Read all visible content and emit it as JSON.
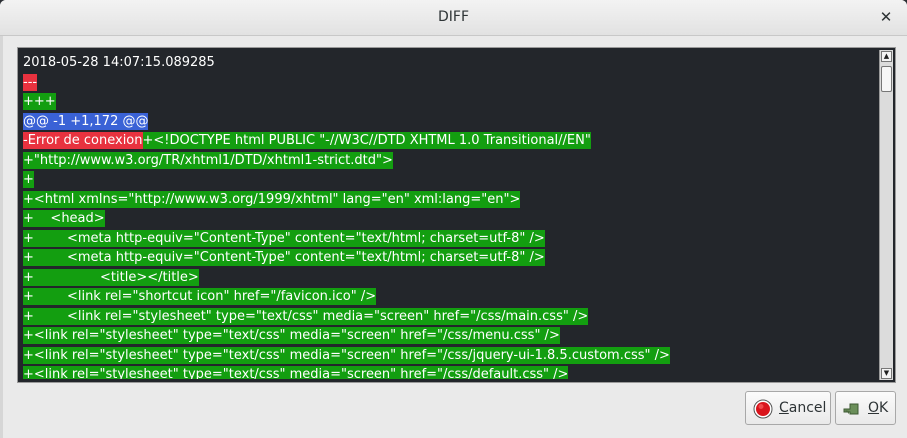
{
  "window": {
    "title": "DIFF",
    "close_glyph": "✕"
  },
  "diff": {
    "lines": [
      [
        {
          "t": "plain",
          "text": "2018-05-28 14:07:15.089285"
        }
      ],
      [
        {
          "t": "del",
          "text": "---"
        }
      ],
      [
        {
          "t": "add",
          "text": "+++"
        }
      ],
      [
        {
          "t": "hunk",
          "text": "@@ -1 +1,172 @@"
        }
      ],
      [
        {
          "t": "del",
          "text": "-Error de conexion"
        },
        {
          "t": "add",
          "text": "+<!DOCTYPE html PUBLIC \"-//W3C//DTD XHTML 1.0 Transitional//EN\""
        }
      ],
      [
        {
          "t": "add",
          "text": "+\"http://www.w3.org/TR/xhtml1/DTD/xhtml1-strict.dtd\">"
        }
      ],
      [
        {
          "t": "add",
          "text": "+"
        }
      ],
      [
        {
          "t": "add",
          "text": "+<html xmlns=\"http://www.w3.org/1999/xhtml\" lang=\"en\" xml:lang=\"en\">"
        }
      ],
      [
        {
          "t": "add",
          "text": "+    <head>"
        }
      ],
      [
        {
          "t": "add",
          "text": "+        <meta http-equiv=\"Content-Type\" content=\"text/html; charset=utf-8\" />"
        }
      ],
      [
        {
          "t": "add",
          "text": "+        <meta http-equiv=\"Content-Type\" content=\"text/html; charset=utf-8\" />"
        }
      ],
      [
        {
          "t": "add",
          "text": "+                <title></title>"
        }
      ],
      [
        {
          "t": "add",
          "text": "+        <link rel=\"shortcut icon\" href=\"/favicon.ico\" />"
        }
      ],
      [
        {
          "t": "add",
          "text": "+        <link rel=\"stylesheet\" type=\"text/css\" media=\"screen\" href=\"/css/main.css\" />"
        }
      ],
      [
        {
          "t": "add",
          "text": "+<link rel=\"stylesheet\" type=\"text/css\" media=\"screen\" href=\"/css/menu.css\" />"
        }
      ],
      [
        {
          "t": "add",
          "text": "+<link rel=\"stylesheet\" type=\"text/css\" media=\"screen\" href=\"/css/jquery-ui-1.8.5.custom.css\" />"
        }
      ],
      [
        {
          "t": "add",
          "text": "+<link rel=\"stylesheet\" type=\"text/css\" media=\"screen\" href=\"/css/default.css\" />"
        }
      ]
    ]
  },
  "buttons": {
    "cancel": {
      "mnemonic": "C",
      "rest": "ancel",
      "icon": "stop-icon",
      "color": "#d9141c"
    },
    "ok": {
      "mnemonic": "O",
      "rest": "K",
      "icon": "check-arrow-icon",
      "color": "#6b8f5a"
    }
  },
  "colors": {
    "deleted": "#e8323f",
    "added": "#139e10",
    "hunk": "#3a62d6",
    "background": "#23262b"
  }
}
